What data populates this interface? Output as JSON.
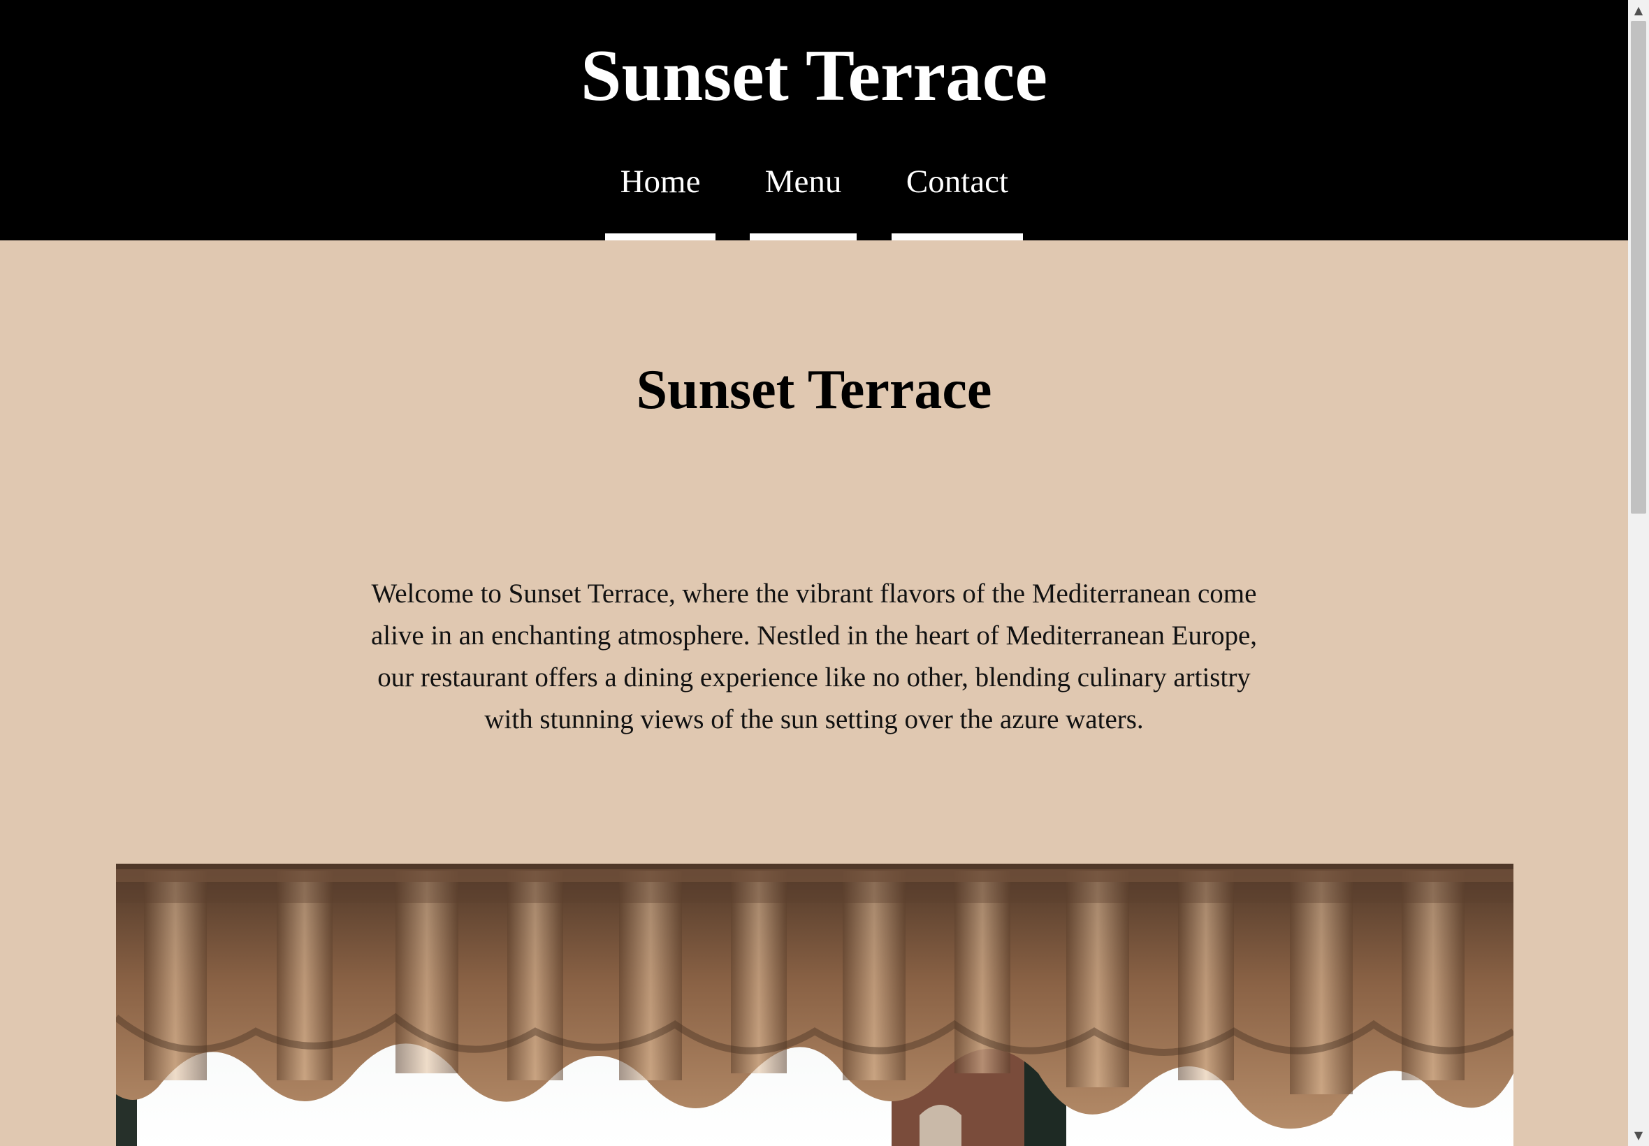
{
  "header": {
    "title": "Sunset Terrace",
    "nav": [
      {
        "label": "Home"
      },
      {
        "label": "Menu"
      },
      {
        "label": "Contact"
      }
    ]
  },
  "main": {
    "title": "Sunset Terrace",
    "intro": "Welcome to Sunset Terrace, where the vibrant flavors of the Mediterranean come alive in an enchanting atmosphere. Nestled in the heart of Mediterranean Europe, our restaurant offers a dining experience like no other, blending culinary artistry with stunning views of the sun setting over the azure waters."
  },
  "colors": {
    "header_bg": "#000000",
    "page_bg": "#e0c8b1",
    "text": "#111111",
    "nav_underline": "#ffffff"
  },
  "icons": {
    "scroll_up": "scroll-up-arrow-icon",
    "scroll_down": "scroll-down-arrow-icon"
  }
}
